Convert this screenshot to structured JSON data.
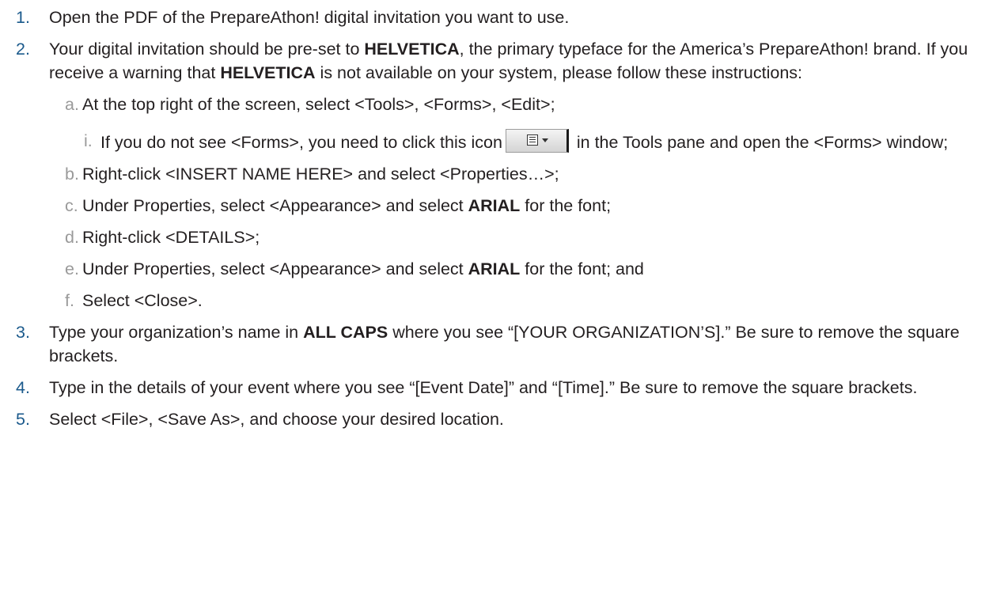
{
  "steps": [
    {
      "num": "1.",
      "text": "Open the PDF of the PrepareAthon! digital invitation you want to use."
    },
    {
      "num": "2.",
      "t1": "Your digital invitation should be pre-set to ",
      "b1": "HELVETICA",
      "t2": ", the primary typeface for the America’s PrepareAthon! brand. If you receive a warning that ",
      "b2": "HELVETICA",
      "t3": " is not available on your system, please follow these instructions:",
      "subs": [
        {
          "letter": "a.",
          "text": "At the top right of the screen, select <Tools>, <Forms>, <Edit>;",
          "subsub": {
            "roman": "i.",
            "t1": "If you do not see <Forms>, you need to click this icon",
            "t2": " in the Tools pane and open the <Forms> window;"
          }
        },
        {
          "letter": "b.",
          "text": "Right-click <INSERT NAME HERE> and select <Properties…>;"
        },
        {
          "letter": "c.",
          "t1": "Under Properties, select <Appearance> and select ",
          "b1": "ARIAL",
          "t2": " for the font;"
        },
        {
          "letter": "d.",
          "text": "Right-click <DETAILS>;"
        },
        {
          "letter": "e.",
          "t1": "Under Properties, select <Appearance> and select ",
          "b1": "ARIAL",
          "t2": " for the font; and"
        },
        {
          "letter": "f.",
          "text": "Select <Close>."
        }
      ]
    },
    {
      "num": "3.",
      "t1": "Type your organization’s name in ",
      "b1": "ALL CAPS",
      "t2": " where you see “[YOUR ORGANIZATION’S].” Be sure to remove the square brackets."
    },
    {
      "num": "4.",
      "text": "Type in the details of your event where you see “[Event Date]” and “[Time].” Be sure to remove the square brackets."
    },
    {
      "num": "5.",
      "text": "Select <File>, <Save As>, and choose your desired location."
    }
  ],
  "icons": {
    "forms_toolbar_button": "forms-dropdown-icon"
  }
}
